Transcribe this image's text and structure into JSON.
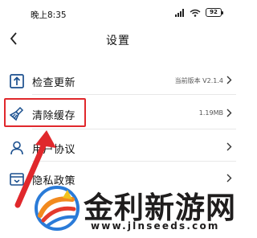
{
  "status_bar": {
    "time": "晚上8:35",
    "battery": "92"
  },
  "header": {
    "title": "设置"
  },
  "settings": [
    {
      "label": "检查更新",
      "value": "当前版本 V2.1.4"
    },
    {
      "label": "清除缓存",
      "value": "1.19MB"
    },
    {
      "label": "用户协议",
      "value": ""
    },
    {
      "label": "隐私政策",
      "value": ""
    }
  ],
  "watermark": {
    "title": "金利新游网",
    "url": "www.jlnseeds.com"
  },
  "colors": {
    "highlight": "#e0282c",
    "icon": "#1a4f8e"
  }
}
